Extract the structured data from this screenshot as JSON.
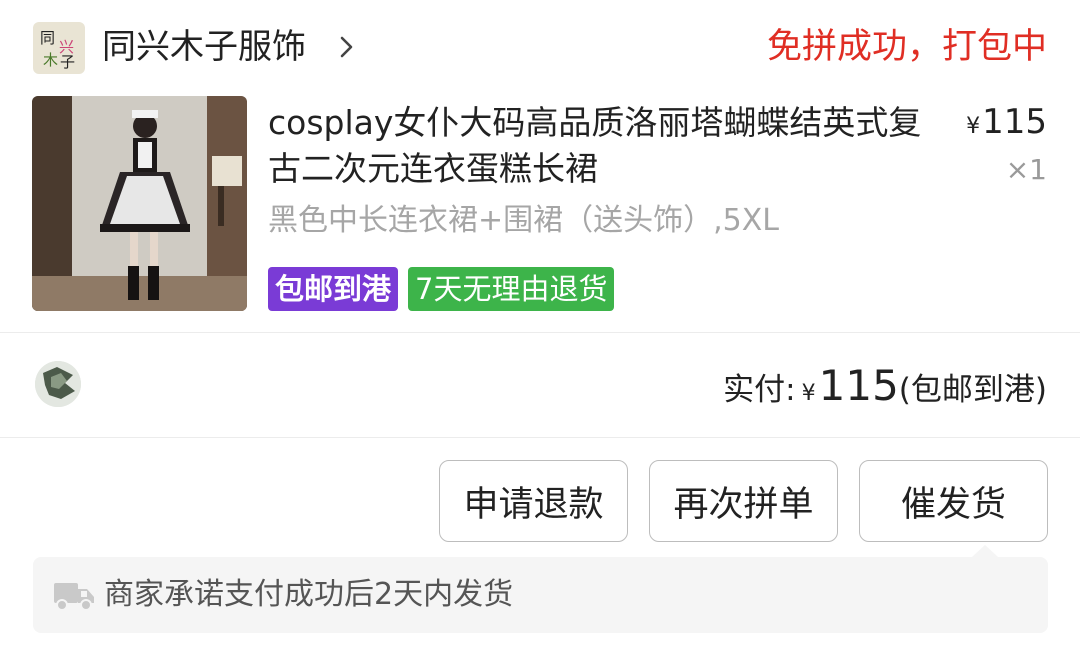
{
  "shop": {
    "name": "同兴木子服饰",
    "logo_text": [
      "同",
      "兴",
      "木",
      "子"
    ],
    "status": "免拼成功，打包中",
    "status_color": "#e02e24"
  },
  "product": {
    "title": "cosplay女仆大码高品质洛丽塔蝴蝶结英式复古二次元连衣蛋糕长裙",
    "currency": "¥",
    "price": "115",
    "quantity": "×1",
    "spec": "黑色中长连衣裙+围裙（送头饰）,5XL",
    "tags": {
      "shipping": "包邮到港",
      "return_policy": "7天无理由退货"
    },
    "tag_colors": {
      "shipping": "#7a3bd6",
      "return_policy": "#3db44a"
    }
  },
  "payment": {
    "label": "实付:",
    "currency": "¥",
    "amount": "115",
    "note": "(包邮到港)"
  },
  "actions": {
    "refund": "申请退款",
    "regroup": "再次拼单",
    "urge": "催发货"
  },
  "notice": {
    "icon": "truck-icon",
    "text": "商家承诺支付成功后2天内发货"
  }
}
